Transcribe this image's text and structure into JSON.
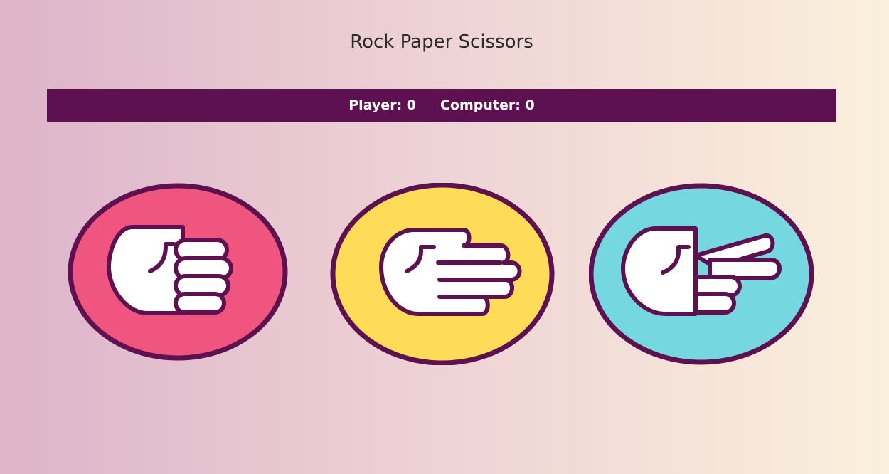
{
  "header": {
    "title": "Rock Paper Scissors"
  },
  "score": {
    "player_label": "Player:",
    "player_score": "0",
    "computer_label": "Computer:",
    "computer_score": "0"
  },
  "choices": [
    {
      "name": "rock",
      "icon": "fist-icon",
      "color": "#ef557e"
    },
    {
      "name": "paper",
      "icon": "open-hand-icon",
      "color": "#ffdc58"
    },
    {
      "name": "scissors",
      "icon": "scissors-hand-icon",
      "color": "#75d8e0"
    }
  ],
  "colors": {
    "accent": "#5e1150",
    "background_start": "#ddb4ca",
    "background_end": "#fbf0dc"
  }
}
